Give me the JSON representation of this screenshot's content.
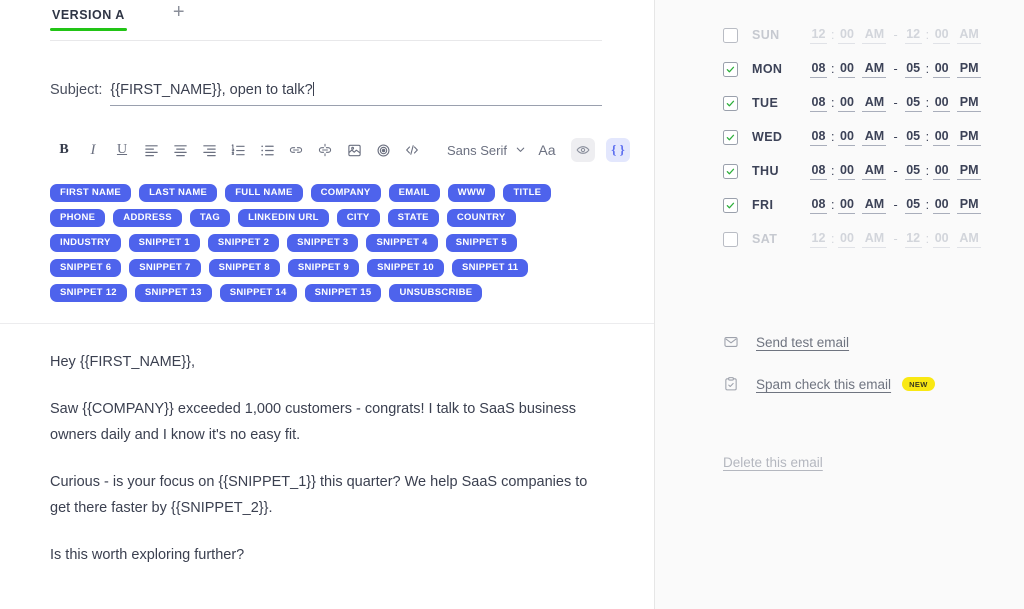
{
  "editor": {
    "tabs": [
      {
        "label": "VERSION A",
        "active": true,
        "accent": "#22c416"
      },
      {
        "label": "+",
        "active": false
      }
    ],
    "subject": {
      "label": "Subject:",
      "value": "{{FIRST_NAME}}, open to talk?",
      "placeholder": "Subject"
    },
    "toolbar": {
      "bold": "B",
      "italic": "I",
      "underline": "U",
      "font_name": "Sans Serif",
      "font_size_label": "Aa",
      "icons": [
        "align-left-icon",
        "align-center-icon",
        "align-right-icon",
        "ordered-list-icon",
        "unordered-list-icon",
        "link-icon",
        "unlink-icon",
        "insert-image-icon",
        "attachment-icon",
        "code-icon",
        "chevron-down-icon",
        "preview-eye-icon",
        "merge-tags-icon"
      ]
    },
    "merge_tags": [
      "FIRST NAME",
      "LAST NAME",
      "FULL NAME",
      "COMPANY",
      "EMAIL",
      "WWW",
      "TITLE",
      "PHONE",
      "ADDRESS",
      "TAG",
      "LINKEDIN URL",
      "CITY",
      "STATE",
      "COUNTRY",
      "INDUSTRY",
      "SNIPPET 1",
      "SNIPPET 2",
      "SNIPPET 3",
      "SNIPPET 4",
      "SNIPPET 5",
      "SNIPPET 6",
      "SNIPPET 7",
      "SNIPPET 8",
      "SNIPPET 9",
      "SNIPPET 10",
      "SNIPPET 11",
      "SNIPPET 12",
      "SNIPPET 13",
      "SNIPPET 14",
      "SNIPPET 15",
      "UNSUBSCRIBE"
    ],
    "pill_color": "#4e63ec",
    "body_paragraphs": [
      "Hey {{FIRST_NAME}},",
      "Saw {{COMPANY}} exceeded 1,000 customers - congrats! I talk to SaaS business owners daily and I know it's no easy fit.",
      "Curious - is your focus on {{SNIPPET_1}} this quarter? We help SaaS companies to get there faster by {{SNIPPET_2}}.",
      "Is this worth exploring further?"
    ]
  },
  "schedule": {
    "days": [
      {
        "day": "SUN",
        "enabled": false,
        "start": {
          "hh": "12",
          "mm": "00",
          "ap": "AM"
        },
        "end": {
          "hh": "12",
          "mm": "00",
          "ap": "AM"
        }
      },
      {
        "day": "MON",
        "enabled": true,
        "start": {
          "hh": "08",
          "mm": "00",
          "ap": "AM"
        },
        "end": {
          "hh": "05",
          "mm": "00",
          "ap": "PM"
        }
      },
      {
        "day": "TUE",
        "enabled": true,
        "start": {
          "hh": "08",
          "mm": "00",
          "ap": "AM"
        },
        "end": {
          "hh": "05",
          "mm": "00",
          "ap": "PM"
        }
      },
      {
        "day": "WED",
        "enabled": true,
        "start": {
          "hh": "08",
          "mm": "00",
          "ap": "AM"
        },
        "end": {
          "hh": "05",
          "mm": "00",
          "ap": "PM"
        }
      },
      {
        "day": "THU",
        "enabled": true,
        "start": {
          "hh": "08",
          "mm": "00",
          "ap": "AM"
        },
        "end": {
          "hh": "05",
          "mm": "00",
          "ap": "PM"
        }
      },
      {
        "day": "FRI",
        "enabled": true,
        "start": {
          "hh": "08",
          "mm": "00",
          "ap": "AM"
        },
        "end": {
          "hh": "05",
          "mm": "00",
          "ap": "PM"
        }
      },
      {
        "day": "SAT",
        "enabled": false,
        "start": {
          "hh": "12",
          "mm": "00",
          "ap": "AM"
        },
        "end": {
          "hh": "12",
          "mm": "00",
          "ap": "AM"
        }
      }
    ],
    "time_separator": ":",
    "range_dash": "-",
    "check_color": "#2cae3a"
  },
  "side_actions": {
    "send_test": {
      "label": "Send test email",
      "icon": "envelope-icon"
    },
    "spam_check": {
      "label": "Spam check this email",
      "icon": "clipboard-check-icon",
      "badge": "NEW",
      "badge_color": "#f9e813"
    },
    "delete": {
      "label": "Delete this email"
    }
  }
}
